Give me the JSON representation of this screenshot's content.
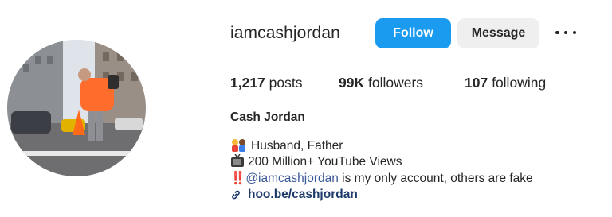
{
  "profile": {
    "username": "iamcashjordan",
    "follow_label": "Follow",
    "message_label": "Message",
    "more_icon": "more-horizontal-icon",
    "stats": {
      "posts_count": "1,217",
      "posts_label": "posts",
      "followers_count": "99K",
      "followers_label": "followers",
      "following_count": "107",
      "following_label": "following"
    },
    "full_name": "Cash Jordan",
    "bio": {
      "line1_icon": "couple-emoji",
      "line1_text": "Husband, Father",
      "line2_icon": "tv-emoji",
      "line2_text": "200 Million+ YouTube Views",
      "line3_prefix": "‼️",
      "line3_mention": "@iamcashjordan",
      "line3_text": " is my only account, others are fake"
    },
    "link_icon": "link-icon",
    "link_text": "hoo.be/cashjordan"
  },
  "colors": {
    "follow": "#1a9bf0",
    "message": "#efefef",
    "text": "#262626",
    "link": "#1e3a6b"
  }
}
